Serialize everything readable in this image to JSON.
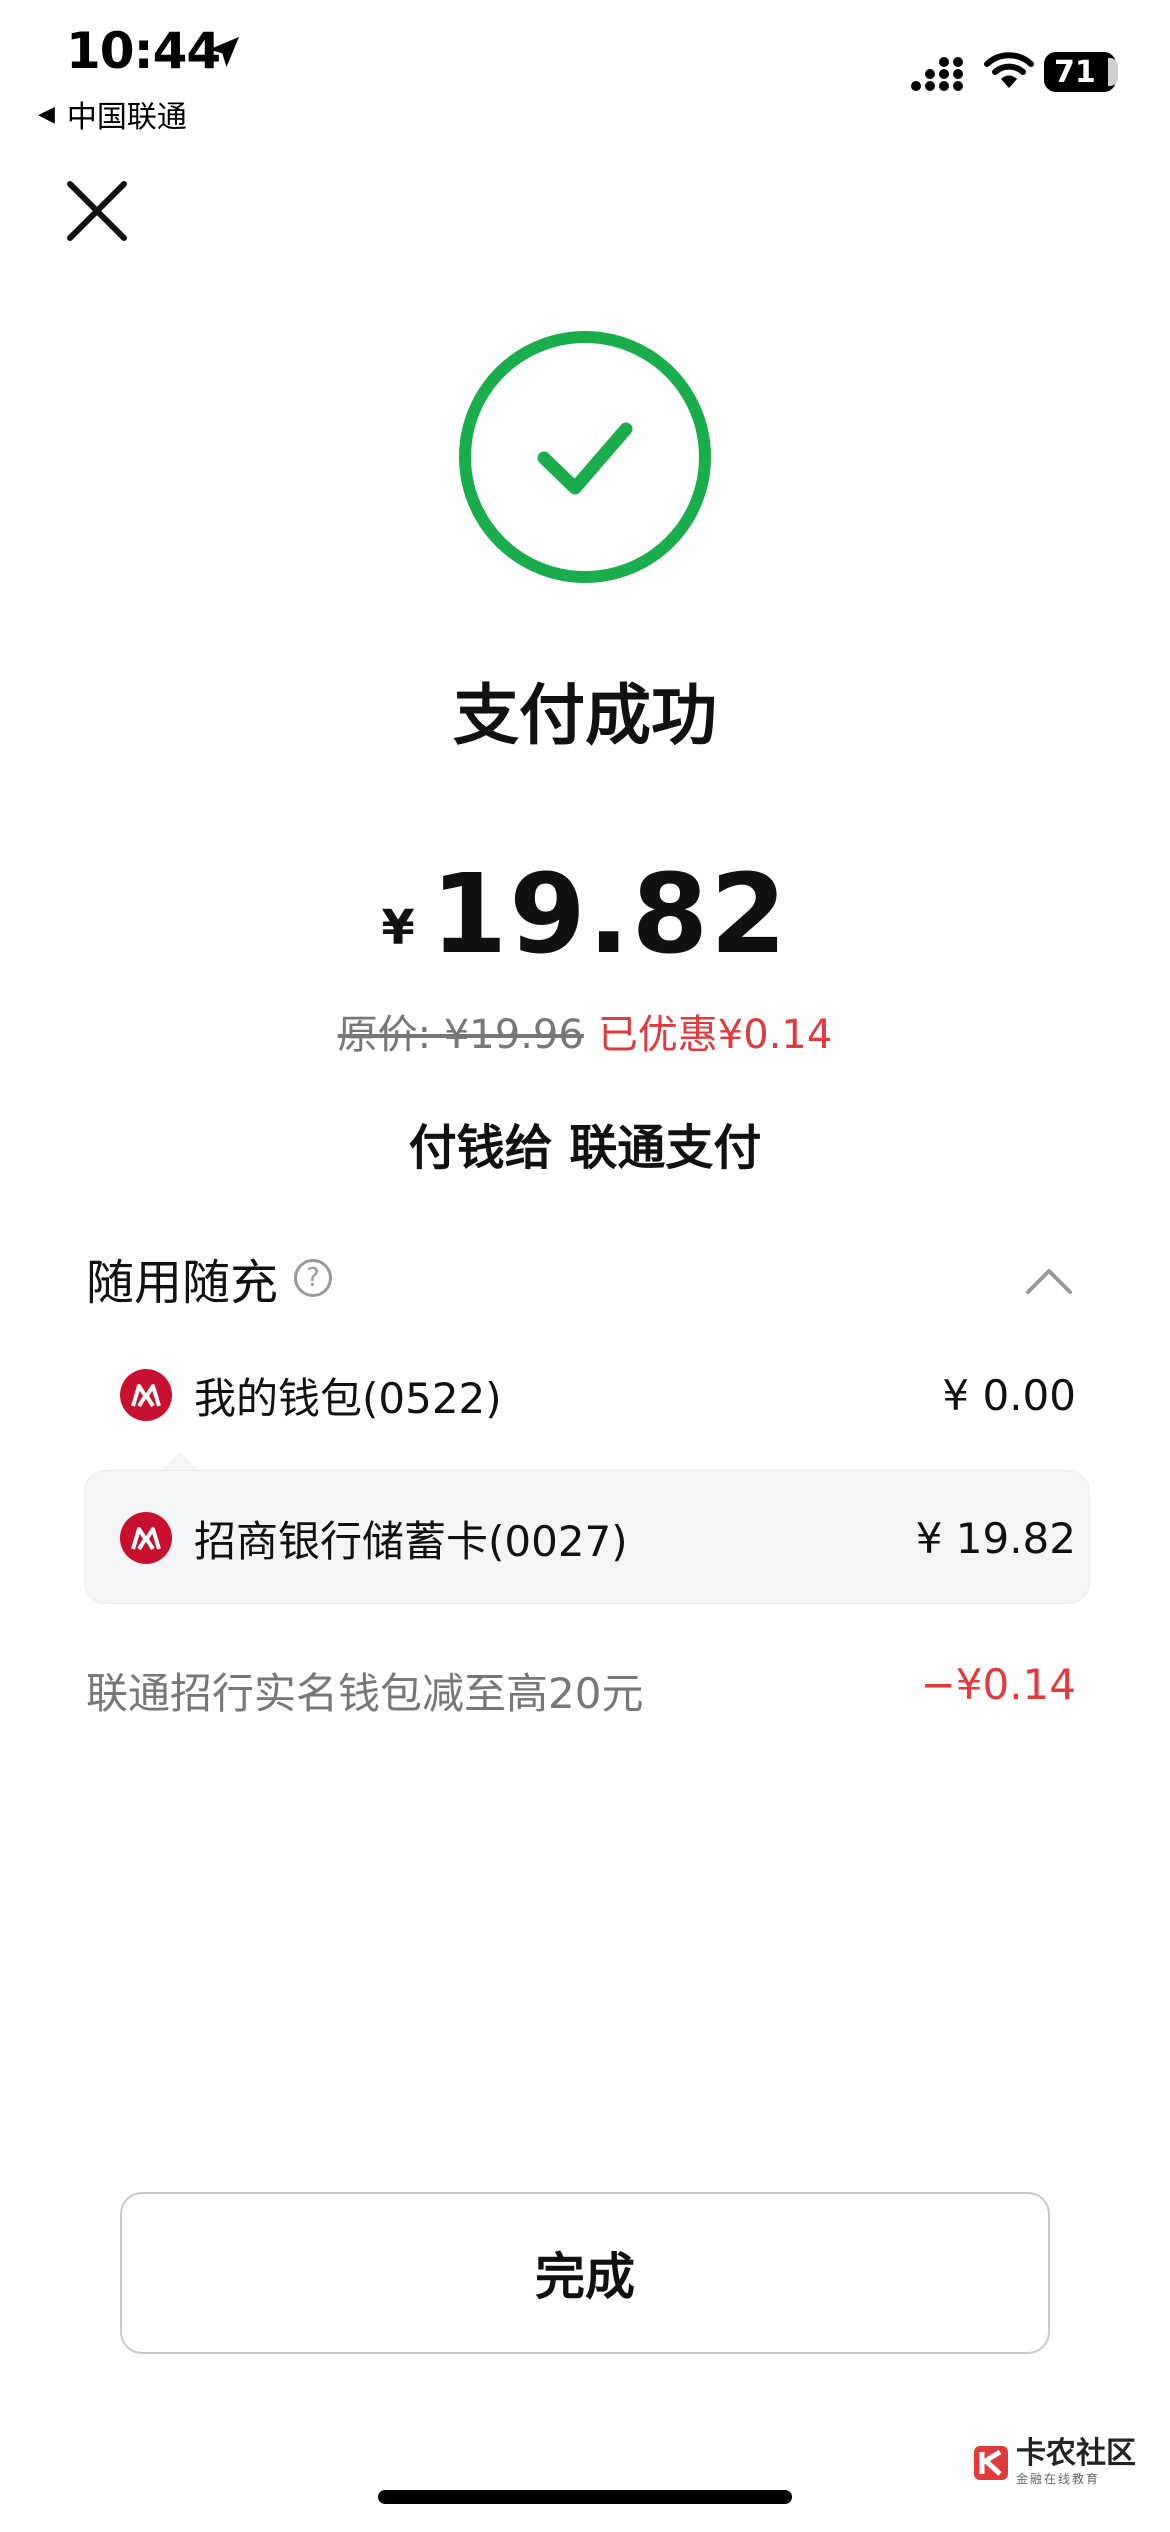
{
  "status_bar": {
    "time": "10:44",
    "carrier": "中国联通",
    "back_glyph": "◀",
    "battery": "71"
  },
  "result": {
    "title": "支付成功",
    "currency_symbol": "¥",
    "amount": "19.82",
    "original_price": "原价: ¥19.96",
    "discount": "已优惠¥0.14",
    "payee": "付钱给 联通支付"
  },
  "payment": {
    "section_title": "随用随充",
    "help_glyph": "?",
    "methods": [
      {
        "label": "我的钱包(0522)",
        "amount": "¥ 0.00"
      },
      {
        "label": "招商银行储蓄卡(0027)",
        "amount": "¥ 19.82"
      }
    ],
    "promo_label": "联通招行实名钱包减至高20元",
    "promo_amount": "−¥0.14"
  },
  "actions": {
    "done_label": "完成"
  },
  "watermark": {
    "main": "卡农社区",
    "sub": "金融在线教育"
  },
  "colors": {
    "success_green": "#1aad4b",
    "discount_red": "#e0393e",
    "bank_red": "#c8102e",
    "panel_bg": "#f4f5f7"
  },
  "icons": {
    "close": "close-icon",
    "success": "checkmark-icon",
    "collapse": "chevron-up-icon",
    "bank": "cmb-bank-logo-icon",
    "help": "question-icon"
  }
}
